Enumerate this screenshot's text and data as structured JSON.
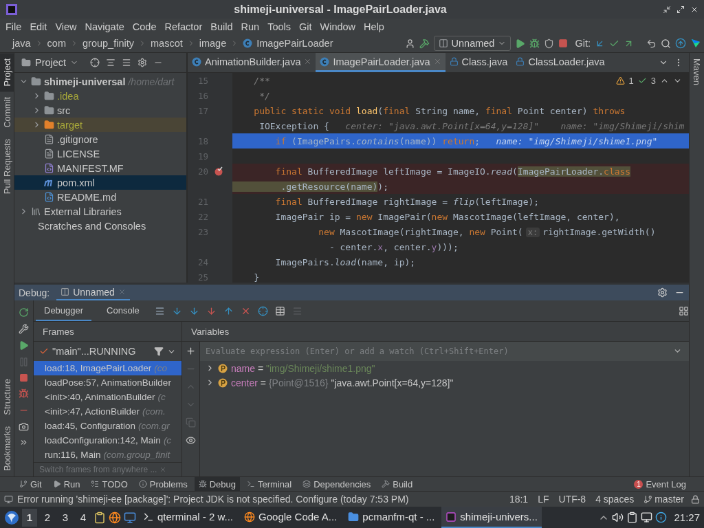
{
  "window": {
    "title": "shimeji-universal - ImagePairLoader.java"
  },
  "menu": [
    "File",
    "Edit",
    "View",
    "Navigate",
    "Code",
    "Refactor",
    "Build",
    "Run",
    "Tools",
    "Git",
    "Window",
    "Help"
  ],
  "breadcrumbs": [
    {
      "label": "java",
      "kind": "package"
    },
    {
      "label": "com",
      "kind": "package"
    },
    {
      "label": "group_finity",
      "kind": "package"
    },
    {
      "label": "mascot",
      "kind": "package"
    },
    {
      "label": "image",
      "kind": "package"
    },
    {
      "label": "ImagePairLoader",
      "kind": "class"
    }
  ],
  "run_config": {
    "label": "Unnamed"
  },
  "git_label": "Git:",
  "left_stripe": {
    "top": [
      {
        "label": "Project",
        "selected": true
      },
      {
        "label": "Commit",
        "selected": false
      },
      {
        "label": "Pull Requests",
        "selected": false
      }
    ],
    "bottom": [
      {
        "label": "Structure",
        "selected": false
      },
      {
        "label": "Bookmarks",
        "selected": false
      }
    ]
  },
  "right_stripe": [
    {
      "label": "Maven",
      "selected": false
    }
  ],
  "project_panel": {
    "title": "Project",
    "tree": [
      {
        "label": "shimeji-universal",
        "path": "/home/dart",
        "kind": "module",
        "expanded": true,
        "selected": false,
        "ignored": false,
        "children": [
          {
            "label": ".idea",
            "kind": "folder",
            "expanded": false,
            "selected": false,
            "ignored": true
          },
          {
            "label": "src",
            "kind": "folder",
            "expanded": false,
            "selected": false,
            "ignored": false
          },
          {
            "label": "target",
            "kind": "excluded-folder",
            "expanded": false,
            "selected": false,
            "ignored": true
          },
          {
            "label": ".gitignore",
            "kind": "ignore-file",
            "selected": false,
            "ignored": false
          },
          {
            "label": "LICENSE",
            "kind": "text-file",
            "selected": false,
            "ignored": false
          },
          {
            "label": "MANIFEST.MF",
            "kind": "manifest",
            "selected": false,
            "ignored": false
          },
          {
            "label": "pom.xml",
            "kind": "maven",
            "selected": true,
            "ignored": false
          },
          {
            "label": "README.md",
            "kind": "markdown",
            "selected": false,
            "ignored": false
          }
        ]
      },
      {
        "label": "External Libraries",
        "kind": "libraries",
        "expanded": false,
        "selected": false,
        "ignored": false
      },
      {
        "label": "Scratches and Consoles",
        "kind": "scratches",
        "selected": false,
        "ignored": false
      }
    ]
  },
  "editor": {
    "tabs": [
      {
        "label": "AnimationBuilder.java",
        "selected": false,
        "closable": true,
        "locked": false
      },
      {
        "label": "ImagePairLoader.java",
        "selected": true,
        "closable": true,
        "locked": false
      },
      {
        "label": "Class.java",
        "selected": false,
        "closable": false,
        "locked": true
      },
      {
        "label": "ClassLoader.java",
        "selected": false,
        "closable": false,
        "locked": true
      }
    ],
    "inspections": {
      "warnings": "1",
      "weak_warnings": "3"
    },
    "lines": [
      {
        "number": "15",
        "kind": "plain",
        "segments": [
          {
            "text": "    /**",
            "kind": "comment"
          }
        ]
      },
      {
        "number": "16",
        "kind": "plain",
        "segments": [
          {
            "text": "     */",
            "kind": "comment"
          }
        ]
      },
      {
        "number": "17",
        "kind": "plain",
        "segments": [
          {
            "text": "    public static void ",
            "kind": "kw"
          },
          {
            "text": "load",
            "kind": "decl"
          },
          {
            "text": "(",
            "kind": "plain"
          },
          {
            "text": "final ",
            "kind": "kw"
          },
          {
            "text": "String name, ",
            "kind": "plain"
          },
          {
            "text": "final ",
            "kind": "kw"
          },
          {
            "text": "Point center) ",
            "kind": "plain"
          },
          {
            "text": "throws",
            "kind": "kw"
          }
        ]
      },
      {
        "kind": "plain",
        "segments": [
          {
            "text": "     IOException {",
            "kind": "plain"
          },
          {
            "text": "   center: \"java.awt.Point[x=64,y=128]\"    name: \"img/Shimeji/shim",
            "kind": "hint"
          }
        ]
      },
      {
        "number": "18",
        "kind": "current",
        "segments": [
          {
            "text": "        if ",
            "kind": "kw"
          },
          {
            "text": "(ImagePairs.",
            "kind": "plain"
          },
          {
            "text": "contains",
            "kind": "static"
          },
          {
            "text": "(name)) ",
            "kind": "plain"
          },
          {
            "text": "return",
            "kind": "kw"
          },
          {
            "text": ";",
            "kind": "plain"
          },
          {
            "text": "   name: \"img/Shimeji/shime1.png\"",
            "kind": "hint"
          }
        ]
      },
      {
        "number": "19",
        "kind": "plain"
      },
      {
        "number": "20",
        "kind": "breakpoint",
        "segments": [
          {
            "text": "        final ",
            "kind": "kw"
          },
          {
            "text": "BufferedImage leftImage = ImageIO.",
            "kind": "plain"
          },
          {
            "text": "read",
            "kind": "static"
          },
          {
            "text": "(",
            "kind": "plain"
          },
          {
            "text": "ImagePairLoader.",
            "kind": "plain",
            "marked": true
          },
          {
            "text": "class",
            "kind": "kw",
            "marked": true
          }
        ]
      },
      {
        "kind": "breakpoint",
        "segments": [
          {
            "text": "         .getResource(name)",
            "kind": "plain",
            "marked": true
          },
          {
            "text": ");",
            "kind": "plain"
          }
        ]
      },
      {
        "number": "21",
        "kind": "plain",
        "segments": [
          {
            "text": "        final ",
            "kind": "kw"
          },
          {
            "text": "BufferedImage rightImage = ",
            "kind": "plain"
          },
          {
            "text": "flip",
            "kind": "static"
          },
          {
            "text": "(leftImage);",
            "kind": "plain"
          }
        ]
      },
      {
        "number": "22",
        "kind": "plain",
        "segments": [
          {
            "text": "        ImagePair ip = ",
            "kind": "plain"
          },
          {
            "text": "new ",
            "kind": "kw"
          },
          {
            "text": "ImagePair(",
            "kind": "plain"
          },
          {
            "text": "new ",
            "kind": "kw"
          },
          {
            "text": "MascotImage(leftImage, center),",
            "kind": "plain"
          }
        ]
      },
      {
        "number": "23",
        "kind": "plain",
        "segments": [
          {
            "text": "                new ",
            "kind": "kw"
          },
          {
            "text": "MascotImage(rightImage, ",
            "kind": "plain"
          },
          {
            "text": "new ",
            "kind": "kw"
          },
          {
            "text": "Point(",
            "kind": "plain"
          },
          {
            "text": "x:",
            "kind": "param"
          },
          {
            "text": "rightImage.getWidth()",
            "kind": "plain"
          }
        ]
      },
      {
        "kind": "plain",
        "segments": [
          {
            "text": "                  - center.",
            "kind": "plain"
          },
          {
            "text": "x",
            "kind": "field"
          },
          {
            "text": ", center.",
            "kind": "plain"
          },
          {
            "text": "y",
            "kind": "field"
          },
          {
            "text": ")));",
            "kind": "plain"
          }
        ]
      },
      {
        "number": "24",
        "kind": "plain",
        "segments": [
          {
            "text": "        ImagePairs.",
            "kind": "plain"
          },
          {
            "text": "load",
            "kind": "static"
          },
          {
            "text": "(name, ip);",
            "kind": "plain"
          }
        ]
      },
      {
        "number": "25",
        "kind": "plain",
        "segments": [
          {
            "text": "    }",
            "kind": "plain"
          }
        ]
      }
    ]
  },
  "debug": {
    "title": "Debug:",
    "session": "Unnamed",
    "tabs": [
      {
        "label": "Debugger",
        "selected": true
      },
      {
        "label": "Console",
        "selected": false
      }
    ],
    "frames_title": "Frames",
    "variables_title": "Variables",
    "thread": "\"main\"...RUNNING",
    "frames": [
      {
        "method": "load:18, ImagePairLoader",
        "package": "(co",
        "selected": true
      },
      {
        "method": "loadPose:57, AnimationBuilder",
        "selected": false
      },
      {
        "method": "<init>:40, AnimationBuilder",
        "package": "(c",
        "selected": false
      },
      {
        "method": "<init>:47, ActionBuilder",
        "package": "(com.",
        "selected": false
      },
      {
        "method": "load:45, Configuration",
        "package": "(com.gr",
        "selected": false
      },
      {
        "method": "loadConfiguration:142, Main",
        "package": "(c",
        "selected": false
      },
      {
        "method": "run:116, Main",
        "package": "(com.group_finit",
        "selected": false
      }
    ],
    "hint": "Switch frames from anywhere ...",
    "eval_placeholder": "Evaluate expression (Enter) or add a watch (Ctrl+Shift+Enter)",
    "variables": [
      {
        "name": "name",
        "separator": "=",
        "value": "\"img/Shimeji/shime1.png\"",
        "expanded": false
      },
      {
        "name": "center",
        "separator": "=",
        "ref": "{Point@1516}",
        "value": "\"java.awt.Point[x=64,y=128]\"",
        "expanded": false
      }
    ]
  },
  "bottom_tabs": [
    {
      "label": "Git",
      "kind": "git",
      "selected": false
    },
    {
      "label": "Run",
      "kind": "run",
      "selected": false
    },
    {
      "label": "TODO",
      "kind": "todo",
      "selected": false
    },
    {
      "label": "Problems",
      "kind": "problems",
      "selected": false
    },
    {
      "label": "Debug",
      "kind": "debug",
      "selected": true
    },
    {
      "label": "Terminal",
      "kind": "terminal",
      "selected": false
    },
    {
      "label": "Dependencies",
      "kind": "dependencies",
      "selected": false
    },
    {
      "label": "Build",
      "kind": "build",
      "selected": false
    }
  ],
  "event_log": {
    "label": "Event Log",
    "count": "1"
  },
  "status_bar": {
    "message": "Error running 'shimeji-ee [package]': Project JDK is not specified. Configure (today 7:53 PM)",
    "items": [
      "18:1",
      "LF",
      "UTF-8",
      "4 spaces"
    ],
    "branch": "master"
  },
  "taskbar": {
    "workspaces": [
      {
        "label": "1",
        "selected": true
      },
      {
        "label": "2",
        "selected": false
      },
      {
        "label": "3",
        "selected": false
      },
      {
        "label": "4",
        "selected": false
      }
    ],
    "tasks": [
      {
        "label": "qterminal - 2 w...",
        "kind": "terminal",
        "selected": false
      },
      {
        "label": "Google Code A...",
        "kind": "browser",
        "selected": false
      },
      {
        "label": "pcmanfm-qt - ...",
        "kind": "files",
        "selected": false
      },
      {
        "label": "shimeji-univers...",
        "kind": "ide",
        "selected": true
      }
    ],
    "clock": "21:27"
  }
}
